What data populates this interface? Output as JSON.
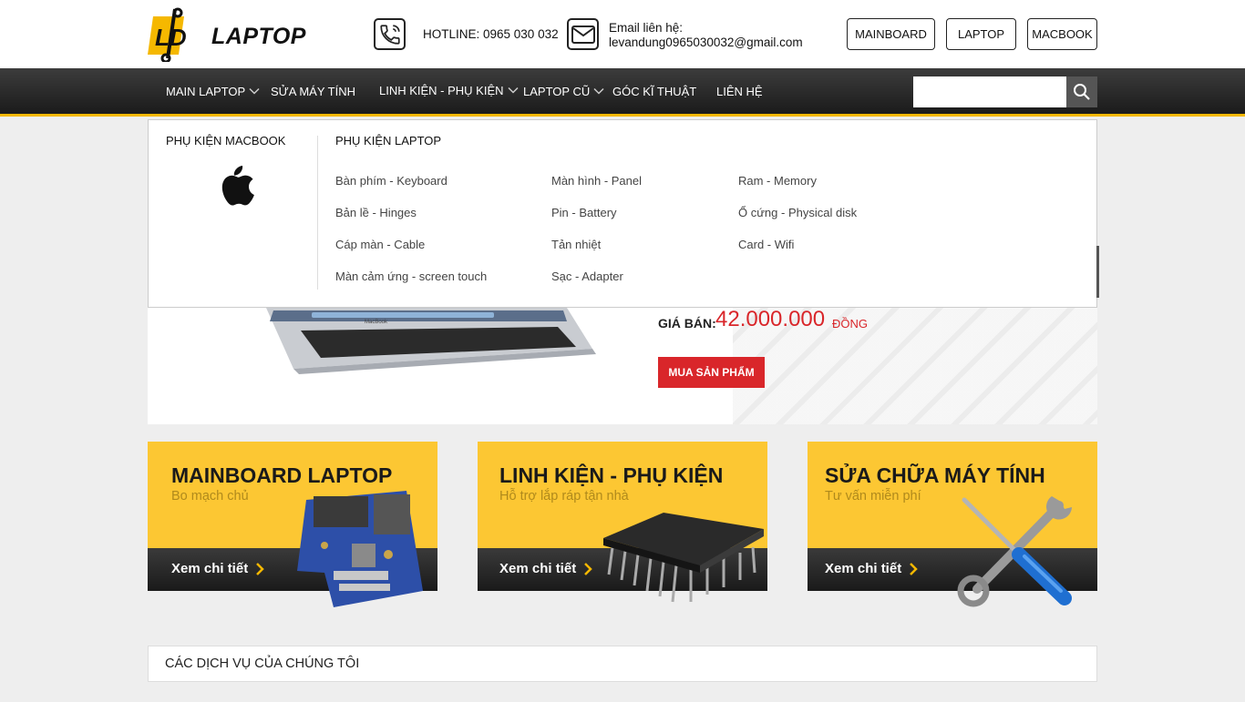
{
  "header": {
    "logo": {
      "mark": "LD",
      "text": "LAPTOP"
    },
    "hotline": "HOTLINE: 0965 030 032",
    "email_label": "Email liên hệ:",
    "email_value": "levandung0965030032@gmail.com",
    "buttons": [
      "MAINBOARD",
      "LAPTOP",
      "MACBOOK"
    ]
  },
  "nav": {
    "items": [
      {
        "label": "MAIN LAPTOP",
        "has_dropdown": true
      },
      {
        "label": "SỬA MÁY TÍNH",
        "has_dropdown": false
      },
      {
        "label": "LINH KIỆN - PHỤ KIỆN",
        "has_dropdown": true,
        "active": true
      },
      {
        "label": "LAPTOP CŨ",
        "has_dropdown": true
      },
      {
        "label": "GÓC KĨ THUẬT",
        "has_dropdown": false
      },
      {
        "label": "LIÊN HỆ",
        "has_dropdown": false
      }
    ],
    "search": {
      "value": "",
      "icon": "search-icon"
    }
  },
  "dropdown": {
    "macbook_title": "PHỤ KIỆN MACBOOK",
    "macbook_icon": "apple-logo-icon",
    "laptop_title": "PHỤ KIỆN LAPTOP",
    "col1": [
      "Bàn phím - Keyboard",
      "Bản lề - Hinges",
      "Cáp màn - Cable",
      "Màn cảm ứng - screen touch"
    ],
    "col2": [
      "Màn hình - Panel",
      "Pin - Battery",
      "Tản nhiệt",
      "Sạc - Adapter"
    ],
    "col3": [
      "Ram - Memory",
      "Ổ cứng - Physical disk",
      "Card - Wifi"
    ]
  },
  "banner": {
    "price_label": "GIÁ BÁN:",
    "price_value": "42.000.000",
    "price_unit": "ĐỒNG",
    "buy_label": "MUA SẢN PHẨM",
    "image": "macbook-laptop-image"
  },
  "cards": [
    {
      "title": "MAINBOARD LAPTOP",
      "subtitle": "Bo mạch chủ",
      "link": "Xem chi tiết",
      "image": "mainboard-image"
    },
    {
      "title": "LINH KIỆN - PHỤ KIỆN",
      "subtitle": "Hỗ trợ lắp ráp tận nhà",
      "link": "Xem chi tiết",
      "image": "chip-image"
    },
    {
      "title": "SỬA CHỮA MÁY TÍNH",
      "subtitle": "Tư vấn miễn phí",
      "link": "Xem chi tiết",
      "image": "tools-image"
    }
  ],
  "services": {
    "title": "CÁC DỊCH VỤ CỦA CHÚNG TÔI"
  },
  "colors": {
    "accent": "#f5b800",
    "card_bg": "#fcc733",
    "price_red": "#d9262a",
    "nav_dark": "#222222"
  }
}
